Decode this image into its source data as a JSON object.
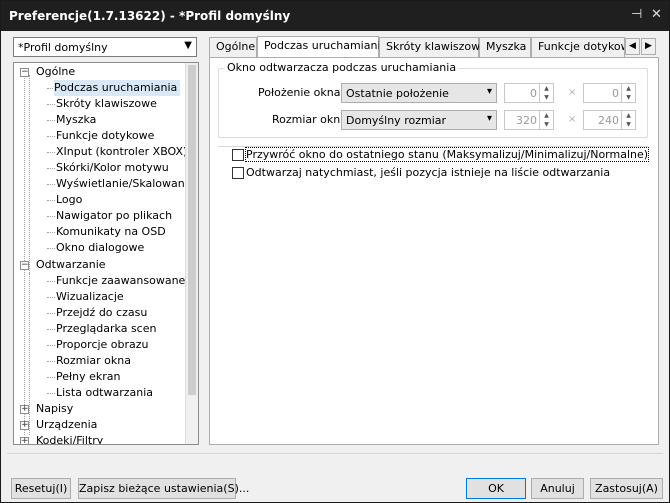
{
  "window": {
    "title": "Preferencje(1.7.13622) - *Profil domyślny"
  },
  "titlebar_icons": {
    "pin": "pin-icon",
    "close": "close-icon"
  },
  "profile": {
    "selected": "*Profil domyślny"
  },
  "tree": {
    "items": [
      {
        "label": "Ogólne"
      },
      {
        "label": "Podczas uruchamiania"
      },
      {
        "label": "Skróty klawiszowe"
      },
      {
        "label": "Myszka"
      },
      {
        "label": "Funkcje dotykowe"
      },
      {
        "label": "XInput (kontroler XBOX)"
      },
      {
        "label": "Skórki/Kolor motywu"
      },
      {
        "label": "Wyświetlanie/Skalowanie sk"
      },
      {
        "label": "Logo"
      },
      {
        "label": "Nawigator po plikach"
      },
      {
        "label": "Komunikaty na OSD"
      },
      {
        "label": "Okno dialogowe"
      },
      {
        "label": "Odtwarzanie"
      },
      {
        "label": "Funkcje zaawansowane"
      },
      {
        "label": "Wizualizacje"
      },
      {
        "label": "Przejdź do czasu"
      },
      {
        "label": "Przeglądarka scen"
      },
      {
        "label": "Proporcje obrazu"
      },
      {
        "label": "Rozmiar okna"
      },
      {
        "label": "Pełny ekran"
      },
      {
        "label": "Lista odtwarzania"
      },
      {
        "label": "Napisy"
      },
      {
        "label": "Urządzenia"
      },
      {
        "label": "Kodeki/Filtry"
      }
    ]
  },
  "tabs": [
    {
      "label": "Ogólne"
    },
    {
      "label": "Podczas uruchamiania"
    },
    {
      "label": "Skróty klawiszowe"
    },
    {
      "label": "Myszka"
    },
    {
      "label": "Funkcje dotykowe"
    }
  ],
  "panel": {
    "group_title": "Okno odtwarzacza podczas uruchamiania",
    "position_label": "Położenie okna:",
    "position_value": "Ostatnie położenie",
    "position_x": "0",
    "position_y": "0",
    "size_label": "Rozmiar okna:",
    "size_value": "Domyślny rozmiar",
    "size_w": "320",
    "size_h": "240",
    "times": "×",
    "check1": "Przywróć okno do ostatniego stanu (Maksymalizuj/Minimalizuj/Normalne)",
    "check2": "Odtwarzaj natychmiast, jeśli pozycja istnieje na liście odtwarzania"
  },
  "buttons": {
    "reset": "Resetuj(I)",
    "save": "Zapisz bieżące ustawienia(S)...",
    "ok": "OK",
    "cancel": "Anuluj",
    "apply": "Zastosuj(A)"
  }
}
